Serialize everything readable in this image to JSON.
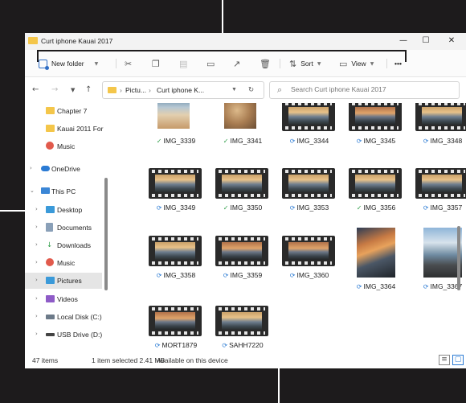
{
  "window": {
    "title": "Curt iphone Kauai 2017",
    "minimize": "—",
    "maximize": "☐",
    "close": "✕"
  },
  "toolbar": {
    "new_folder": "New folder",
    "sort": "Sort",
    "view": "View",
    "more": "•••"
  },
  "address": {
    "crumb1": "Pictu...",
    "crumb2": "Curt iphone K...",
    "search_placeholder": "Search Curt iphone Kauai 2017"
  },
  "sidebar": {
    "items": [
      {
        "label": "Chapter 7",
        "icon": "folder-icon"
      },
      {
        "label": "Kauai 2011 For",
        "icon": "folder-icon"
      },
      {
        "label": "Music",
        "icon": "music-icon"
      },
      {
        "label": "OneDrive",
        "icon": "cloud-icon"
      },
      {
        "label": "This PC",
        "icon": "pc-icon"
      },
      {
        "label": "Desktop",
        "icon": "desktop-icon"
      },
      {
        "label": "Documents",
        "icon": "documents-icon"
      },
      {
        "label": "Downloads",
        "icon": "download-icon"
      },
      {
        "label": "Music",
        "icon": "music-icon"
      },
      {
        "label": "Pictures",
        "icon": "pictures-icon"
      },
      {
        "label": "Videos",
        "icon": "videos-icon"
      },
      {
        "label": "Local Disk (C:)",
        "icon": "disk-icon"
      },
      {
        "label": "USB Drive (D:)",
        "icon": "usb-icon"
      }
    ]
  },
  "files": [
    {
      "name": "IMG_3339",
      "kind": "photo",
      "status": "ok"
    },
    {
      "name": "IMG_3341",
      "kind": "photo",
      "status": "ok"
    },
    {
      "name": "IMG_3344",
      "kind": "video",
      "status": "sync"
    },
    {
      "name": "IMG_3345",
      "kind": "video",
      "status": "sync"
    },
    {
      "name": "IMG_3348",
      "kind": "video",
      "status": "sync"
    },
    {
      "name": "IMG_3349",
      "kind": "video",
      "status": "sync"
    },
    {
      "name": "IMG_3350",
      "kind": "video",
      "status": "ok"
    },
    {
      "name": "IMG_3353",
      "kind": "video",
      "status": "sync"
    },
    {
      "name": "IMG_3356",
      "kind": "video",
      "status": "ok"
    },
    {
      "name": "IMG_3357",
      "kind": "video",
      "status": "sync"
    },
    {
      "name": "IMG_3358",
      "kind": "video",
      "status": "sync"
    },
    {
      "name": "IMG_3359",
      "kind": "video",
      "status": "sync"
    },
    {
      "name": "IMG_3360",
      "kind": "video",
      "status": "sync"
    },
    {
      "name": "IMG_3364",
      "kind": "photo",
      "status": "sync"
    },
    {
      "name": "IMG_3367",
      "kind": "photo",
      "status": "sync"
    },
    {
      "name": "MORT1879",
      "kind": "video",
      "status": "sync"
    },
    {
      "name": "SAHH7220",
      "kind": "video",
      "status": "sync"
    }
  ],
  "status": {
    "count": "47 items",
    "selection": "1 item selected  2.41 MB",
    "availability": "Available on this device"
  },
  "colors": {
    "accent": "#2b7bd4",
    "folder": "#f4c64a",
    "ok": "#2e9d48"
  }
}
